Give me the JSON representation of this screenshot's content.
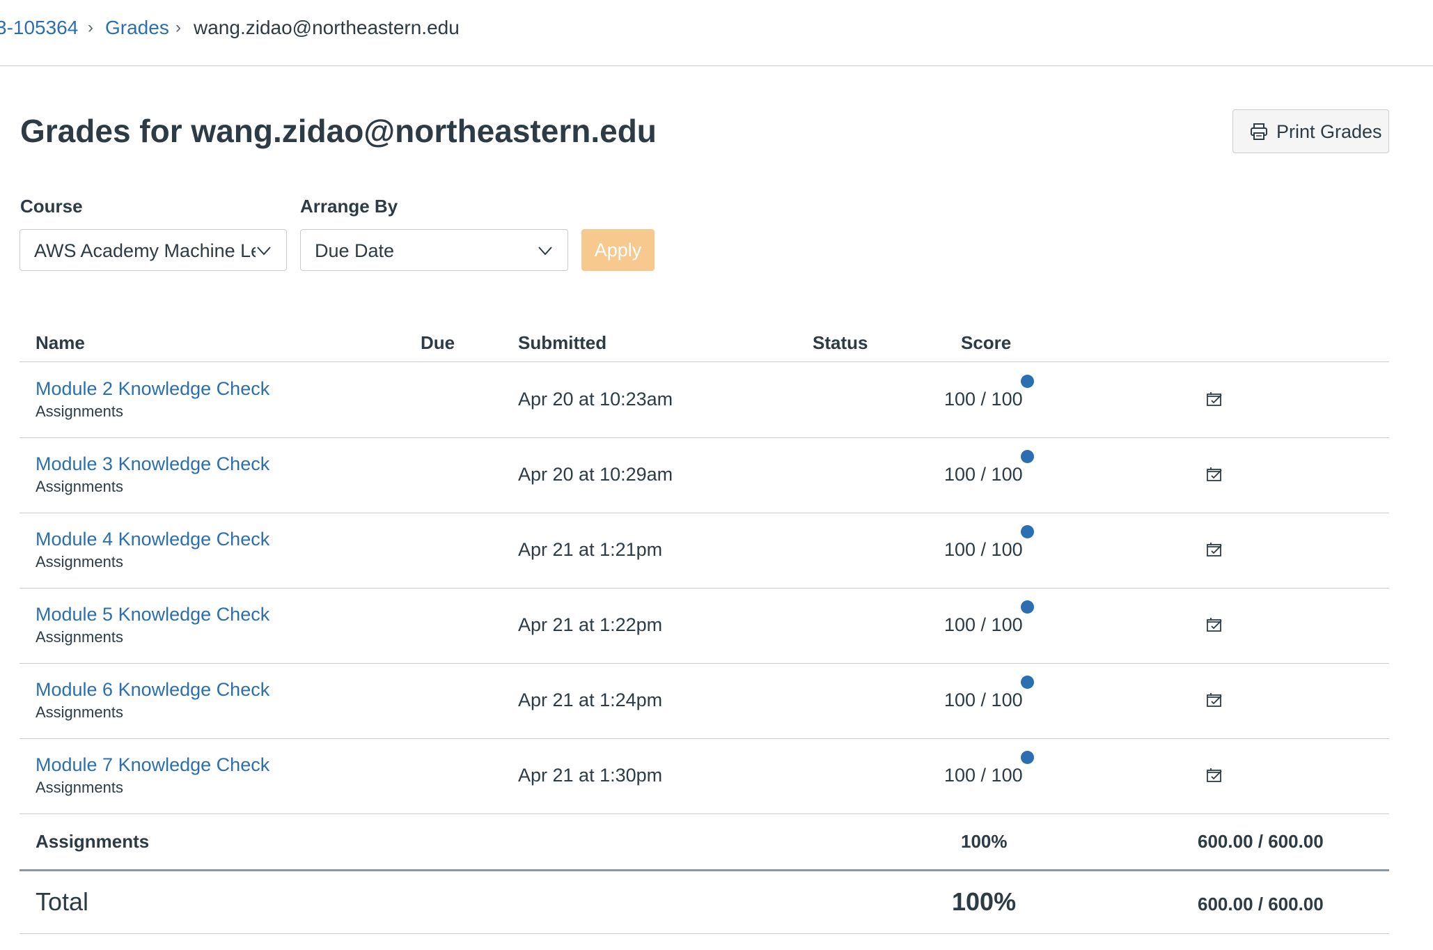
{
  "breadcrumb": {
    "course_id": "3-105364",
    "grades": "Grades",
    "student": "wang.zidao@northeastern.edu",
    "separator": "›"
  },
  "page_title": "Grades for wang.zidao@northeastern.edu",
  "print_button": {
    "label": "Print Grades",
    "icon": "printer-icon"
  },
  "filters": {
    "course_label": "Course",
    "course_value": "AWS Academy Machine Le",
    "arrange_label": "Arrange By",
    "arrange_value": "Due Date",
    "apply_label": "Apply"
  },
  "table": {
    "headers": {
      "name": "Name",
      "due": "Due",
      "submitted": "Submitted",
      "status": "Status",
      "score": "Score"
    },
    "rows": [
      {
        "name": "Module 2 Knowledge Check",
        "category": "Assignments",
        "due": "",
        "submitted": "Apr 20 at 10:23am",
        "status": "",
        "score": "100 / 100"
      },
      {
        "name": "Module 3 Knowledge Check",
        "category": "Assignments",
        "due": "",
        "submitted": "Apr 20 at 10:29am",
        "status": "",
        "score": "100 / 100"
      },
      {
        "name": "Module 4 Knowledge Check",
        "category": "Assignments",
        "due": "",
        "submitted": "Apr 21 at 1:21pm",
        "status": "",
        "score": "100 / 100"
      },
      {
        "name": "Module 5 Knowledge Check",
        "category": "Assignments",
        "due": "",
        "submitted": "Apr 21 at 1:22pm",
        "status": "",
        "score": "100 / 100"
      },
      {
        "name": "Module 6 Knowledge Check",
        "category": "Assignments",
        "due": "",
        "submitted": "Apr 21 at 1:24pm",
        "status": "",
        "score": "100 / 100"
      },
      {
        "name": "Module 7 Knowledge Check",
        "category": "Assignments",
        "due": "",
        "submitted": "Apr 21 at 1:30pm",
        "status": "",
        "score": "100 / 100"
      }
    ],
    "group_summary": {
      "label": "Assignments",
      "percent": "100%",
      "points": "600.00 / 600.00"
    },
    "total": {
      "label": "Total",
      "percent": "100%",
      "points": "600.00 / 600.00"
    }
  },
  "colors": {
    "link": "#2b6fb1",
    "text": "#2d3b45",
    "apply_button": "#f7c98e",
    "unread_dot": "#2b6fb1",
    "border": "#c7cdd1"
  }
}
